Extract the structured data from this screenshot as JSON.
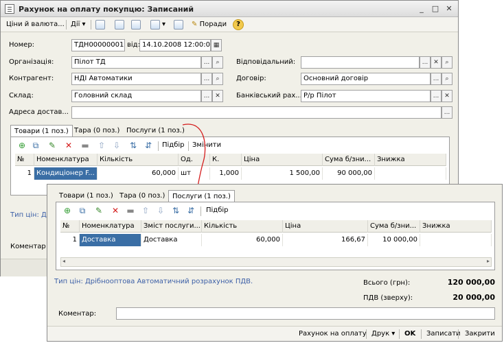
{
  "back": {
    "title": "Рахунок на оплату покупцю: Записаний",
    "toolbar": {
      "prices": "Ціни й валюта...",
      "actions": "Дії",
      "tips": "Поради"
    },
    "labels": {
      "number": "Номер:",
      "from": "від:",
      "organization": "Організація:",
      "counterparty": "Контрагент:",
      "warehouse": "Склад:",
      "address": "Адреса достав...",
      "responsible": "Відповідальний:",
      "contract": "Договір:",
      "bank_account": "Банківський рах..."
    },
    "values": {
      "number": "ТДН00000001",
      "date": "14.10.2008 12:00:00",
      "organization": "Пілот ТД",
      "counterparty": "НДІ Автоматики",
      "warehouse": "Головний склад",
      "contract": "Основний договір",
      "bank_account": "Р/р Пілот",
      "responsible": "",
      "address": ""
    },
    "tabs": [
      "Товари (1 поз.)",
      "Тара (0 поз.)",
      "Послуги (1 поз.)"
    ],
    "grid_actions": {
      "select": "Підбір",
      "change": "Змінити"
    },
    "columns": [
      "№",
      "Номенклатура",
      "Кількість",
      "Од.",
      "К.",
      "Ціна",
      "Сума б/зни...",
      "Знижка"
    ],
    "rows": [
      {
        "n": "1",
        "item": "Кондиціонер F...",
        "qty": "60,000",
        "unit": "шт",
        "k": "1,000",
        "price": "1 500,00",
        "sum": "90 000,00",
        "discount": ""
      }
    ],
    "price_type_short": "Тип цін: Дрі",
    "comment_short": "Коментар"
  },
  "front": {
    "tabs": [
      "Товари (1 поз.)",
      "Тара (0 поз.)",
      "Послуги (1 поз.)"
    ],
    "grid_actions": {
      "select": "Підбір"
    },
    "columns": [
      "№",
      "Номенклатура",
      "Зміст послуги...",
      "Кількість",
      "Ціна",
      "Сума б/зни...",
      "Знижка"
    ],
    "rows": [
      {
        "n": "1",
        "item": "Доставка",
        "content": "Доставка",
        "qty": "60,000",
        "price": "166,67",
        "sum": "10 000,00",
        "discount": ""
      }
    ],
    "price_type": "Тип цін: Дрібнооптова Автоматичний розрахунок ПДВ.",
    "total_label": "Всього (грн):",
    "total_value": "120 000,00",
    "vat_label": "ПДВ (зверху):",
    "vat_value": "20 000,00",
    "comment_label": "Коментар:",
    "comment_value": "",
    "bottom": {
      "invoice": "Рахунок на оплату",
      "print": "Друк",
      "ok": "OK",
      "save": "Записати",
      "close": "Закрити"
    }
  },
  "colors": {
    "selection": "#3a6ea5",
    "link": "#3b5ea6",
    "connector": "#d41b1b"
  }
}
